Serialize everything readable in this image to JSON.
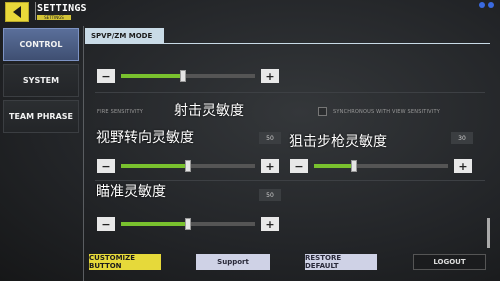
{
  "header": {
    "title": "SETTINGS",
    "subtitle": "SETTINGS"
  },
  "sidebar": {
    "items": [
      {
        "label": "CONTROL",
        "active": true
      },
      {
        "label": "SYSTEM",
        "active": false
      },
      {
        "label": "TEAM PHRASE",
        "active": false
      }
    ]
  },
  "tab": {
    "label": "SPVP/ZM MODE"
  },
  "sliders": {
    "top": {
      "level": 0.46
    },
    "view": {
      "label": "视野转向灵敏度",
      "value": "50",
      "level": 0.5
    },
    "sniper": {
      "label": "狙击步枪灵敏度",
      "value": "30",
      "level": 0.3
    },
    "aim": {
      "label": "瞄准灵敏度",
      "value": "50",
      "level": 0.5
    }
  },
  "fire": {
    "label": "FIRE SENSITIVITY",
    "overlay": "射击灵敏度"
  },
  "sync": {
    "label": "SYNCHRONOUS WITH VIEW SENSITIVITY"
  },
  "buttons": {
    "minus": "−",
    "plus": "+",
    "customize": "CUSTOMIZE BUTTON",
    "support": "Support",
    "restore": "RESTORE DEFAULT",
    "logout": "LOGOUT"
  },
  "colors": {
    "accent": "#e6d93a",
    "fill": "#79c12e",
    "tab": "#c9dbe7"
  }
}
